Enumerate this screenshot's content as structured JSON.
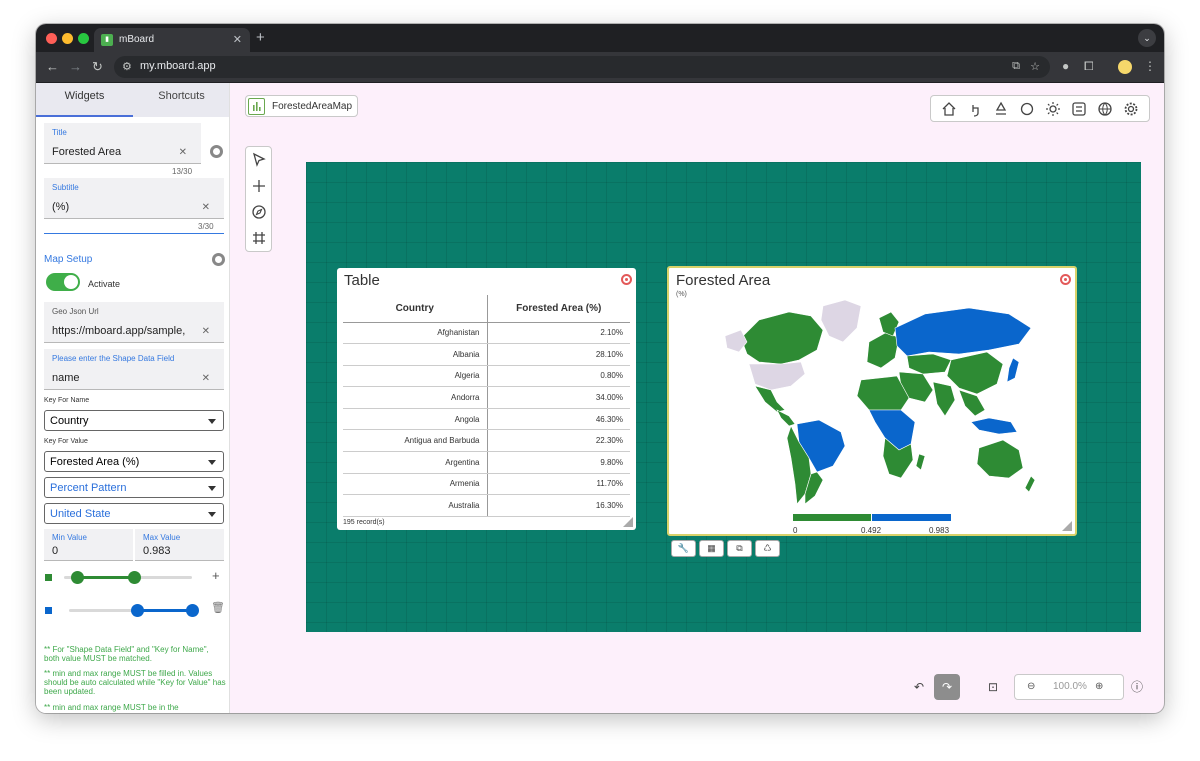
{
  "browser": {
    "tab_title": "mBoard",
    "tab_favicon": "bar-chart-icon",
    "url": "my.mboard.app"
  },
  "sidebar": {
    "tabs": [
      "Widgets",
      "Shortcuts"
    ],
    "title_field": {
      "label": "Title",
      "value": "Forested Area",
      "counter": "13/30"
    },
    "subtitle_field": {
      "label": "Subtitle",
      "value": "(%)",
      "counter": "3/30"
    },
    "map_setup": {
      "heading": "Map Setup",
      "activate_label": "Activate",
      "geojson_field": {
        "label": "Geo Json Url",
        "value": "https://mboard.app/sample,"
      },
      "shape_field": {
        "label": "Please enter the Shape Data Field",
        "value": "name"
      },
      "key_name_label": "Key For Name",
      "key_name_value": "Country",
      "key_value_label": "Key For Value",
      "key_value_value": "Forested Area (%)",
      "pattern_value": "Percent Pattern",
      "region_value": "United State",
      "min_label": "Min Value",
      "min_value": "0",
      "max_label": "Max Value",
      "max_value": "0.983",
      "range_green": [
        0.1,
        0.55
      ],
      "range_blue": [
        0.55,
        1.0
      ],
      "notes": [
        "** For \"Shape Data Field\" and \"Key for Name\", both value MUST be matched.",
        "** min and max range MUST be filled in. Values should be auto calculated while \"Key for Value\" has been updated.",
        "** min and max range MUST be in the"
      ]
    }
  },
  "topchip": {
    "label": "ForestedAreaMap"
  },
  "table_widget": {
    "title": "Table",
    "columns": [
      "Country",
      "Forested Area (%)"
    ],
    "rows": [
      [
        "Afghanistan",
        "2.10%"
      ],
      [
        "Albania",
        "28.10%"
      ],
      [
        "Algeria",
        "0.80%"
      ],
      [
        "Andorra",
        "34.00%"
      ],
      [
        "Angola",
        "46.30%"
      ],
      [
        "Antigua and Barbuda",
        "22.30%"
      ],
      [
        "Argentina",
        "9.80%"
      ],
      [
        "Armenia",
        "11.70%"
      ],
      [
        "Australia",
        "16.30%"
      ]
    ],
    "records": "195 record(s)"
  },
  "map_widget": {
    "title": "Forested Area",
    "subtitle": "(%)",
    "legend": [
      "0",
      "0.492",
      "0.983"
    ],
    "colors": {
      "low": "#2e8b34",
      "high": "#0a66cc",
      "nodata": "#ddd6e4"
    }
  },
  "zoom": {
    "level": "100.0%"
  },
  "colors": {
    "canvas": "#0a7d6b",
    "accent_green": "#3fae49",
    "accent_blue": "#2a6fdb"
  }
}
